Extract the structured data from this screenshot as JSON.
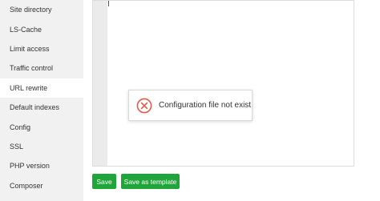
{
  "sidebar": {
    "items": [
      {
        "label": "Site directory",
        "active": false
      },
      {
        "label": "LS-Cache",
        "active": false
      },
      {
        "label": "Limit access",
        "active": false
      },
      {
        "label": "Traffic control",
        "active": false
      },
      {
        "label": "URL rewrite",
        "active": true
      },
      {
        "label": "Default indexes",
        "active": false
      },
      {
        "label": "Config",
        "active": false
      },
      {
        "label": "SSL",
        "active": false
      },
      {
        "label": "PHP version",
        "active": false
      },
      {
        "label": "Composer",
        "active": false
      }
    ]
  },
  "editor": {
    "content": ""
  },
  "dialog": {
    "icon": "error-circle-icon",
    "message": "Configuration file not exist",
    "icon_color": "#e05a4a"
  },
  "actions": {
    "save_label": "Save",
    "save_template_label": "Save as template",
    "button_color": "#20a53a"
  }
}
